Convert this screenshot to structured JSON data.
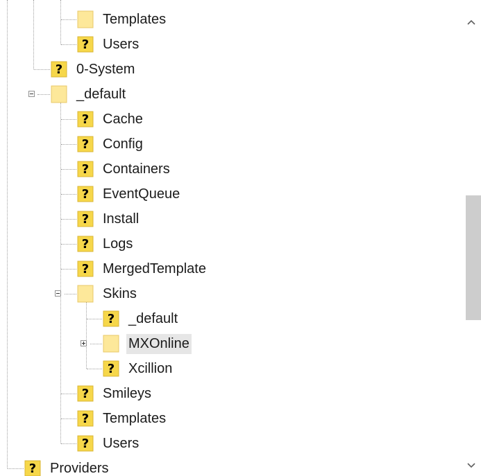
{
  "tree": {
    "nodes": [
      {
        "label": "Templates",
        "icon": "folder-icon"
      },
      {
        "label": "Users",
        "icon": "unknown-file-icon"
      },
      {
        "label": "0-System",
        "icon": "unknown-file-icon"
      },
      {
        "label": "_default",
        "icon": "folder-icon",
        "expanded": true
      },
      {
        "label": "Cache",
        "icon": "unknown-file-icon"
      },
      {
        "label": "Config",
        "icon": "unknown-file-icon"
      },
      {
        "label": "Containers",
        "icon": "unknown-file-icon"
      },
      {
        "label": "EventQueue",
        "icon": "unknown-file-icon"
      },
      {
        "label": "Install",
        "icon": "unknown-file-icon"
      },
      {
        "label": "Logs",
        "icon": "unknown-file-icon"
      },
      {
        "label": "MergedTemplate",
        "icon": "unknown-file-icon"
      },
      {
        "label": "Skins",
        "icon": "folder-icon",
        "expanded": true
      },
      {
        "label": "_default",
        "icon": "unknown-file-icon"
      },
      {
        "label": "MXOnline",
        "icon": "folder-icon",
        "expanded": false,
        "selected": true
      },
      {
        "label": "Xcillion",
        "icon": "unknown-file-icon"
      },
      {
        "label": "Smileys",
        "icon": "unknown-file-icon"
      },
      {
        "label": "Templates",
        "icon": "unknown-file-icon"
      },
      {
        "label": "Users",
        "icon": "unknown-file-icon"
      },
      {
        "label": "Providers",
        "icon": "unknown-file-icon"
      }
    ]
  },
  "colors": {
    "folder": "#fde89a",
    "folder_edge": "#e8c86a",
    "unknown_bg": "#f6d74a",
    "unknown_mark": "#000000",
    "scroll_thumb": "#cdcdcd",
    "selection": "#e6e6e6"
  },
  "scrollbar": {
    "up_icon": "chevron-up-icon",
    "down_icon": "chevron-down-icon"
  }
}
